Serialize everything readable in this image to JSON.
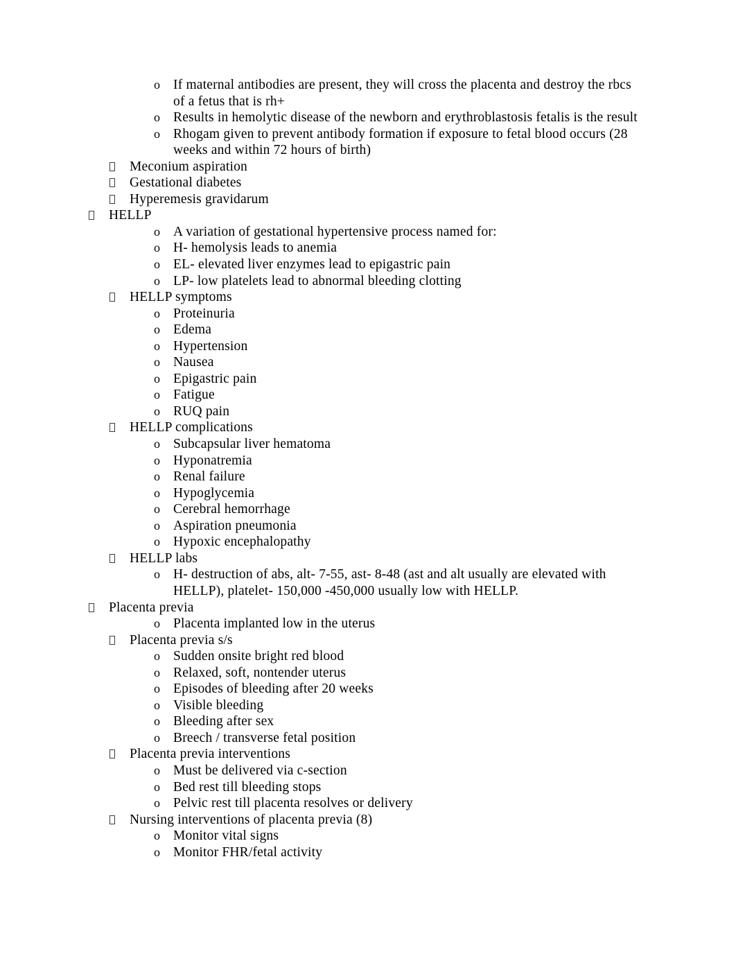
{
  "document": {
    "page_background": "#ffffff",
    "text_color": "#000000",
    "outline": [
      {
        "level": 3,
        "bullet": "o",
        "text": "If maternal antibodies are present, they will cross the placenta and destroy the rbcs of a fetus that is rh+"
      },
      {
        "level": 3,
        "bullet": "o",
        "text": "Results in hemolytic disease of the newborn and erythroblastosis fetalis is the result"
      },
      {
        "level": 3,
        "bullet": "o",
        "text": "Rhogam given to prevent antibody formation if exposure to fetal blood occurs (28 weeks and within 72 hours of birth)"
      },
      {
        "level": 2,
        "bullet": "box",
        "text": " Meconium aspiration"
      },
      {
        "level": 2,
        "bullet": "box",
        "text": "Gestational diabetes"
      },
      {
        "level": 2,
        "bullet": "box",
        "text": "Hyperemesis gravidarum"
      },
      {
        "level": 1,
        "bullet": "box",
        "text": "HELLP"
      },
      {
        "level": 3,
        "bullet": "o",
        "text": "A variation of gestational hypertensive process named for:"
      },
      {
        "level": 3,
        "bullet": "o",
        "text": "H- hemolysis leads to anemia"
      },
      {
        "level": 3,
        "bullet": "o",
        "text": "EL- elevated liver enzymes lead to epigastric pain"
      },
      {
        "level": 3,
        "bullet": "o",
        "text": "LP- low platelets lead to abnormal bleeding clotting"
      },
      {
        "level": 2,
        "bullet": "box",
        "text": "HELLP symptoms"
      },
      {
        "level": 3,
        "bullet": "o",
        "text": "Proteinuria"
      },
      {
        "level": 3,
        "bullet": "o",
        "text": "Edema"
      },
      {
        "level": 3,
        "bullet": "o",
        "text": "Hypertension"
      },
      {
        "level": 3,
        "bullet": "o",
        "text": "Nausea"
      },
      {
        "level": 3,
        "bullet": "o",
        "text": "Epigastric pain"
      },
      {
        "level": 3,
        "bullet": "o",
        "text": "Fatigue"
      },
      {
        "level": 3,
        "bullet": "o",
        "text": "RUQ pain"
      },
      {
        "level": 2,
        "bullet": "box",
        "text": "HELLP complications"
      },
      {
        "level": 3,
        "bullet": "o",
        "text": "Subcapsular liver hematoma"
      },
      {
        "level": 3,
        "bullet": "o",
        "text": "Hyponatremia"
      },
      {
        "level": 3,
        "bullet": "o",
        "text": "Renal failure"
      },
      {
        "level": 3,
        "bullet": "o",
        "text": "Hypoglycemia"
      },
      {
        "level": 3,
        "bullet": "o",
        "text": "Cerebral hemorrhage"
      },
      {
        "level": 3,
        "bullet": "o",
        "text": "Aspiration pneumonia"
      },
      {
        "level": 3,
        "bullet": "o",
        "text": "Hypoxic encephalopathy"
      },
      {
        "level": 2,
        "bullet": "box",
        "text": "HELLP labs"
      },
      {
        "level": 3,
        "bullet": "o",
        "text": "H- destruction of abs, alt- 7-55, ast- 8-48 (ast and alt usually are elevated with HELLP), platelet- 150,000 -450,000 usually low with HELLP."
      },
      {
        "level": 1,
        "bullet": "box",
        "text": "Placenta previa"
      },
      {
        "level": 3,
        "bullet": "o",
        "text": "Placenta implanted low in the uterus"
      },
      {
        "level": 2,
        "bullet": "box",
        "text": "Placenta previa s/s"
      },
      {
        "level": 3,
        "bullet": "o",
        "text": "Sudden onsite bright red blood"
      },
      {
        "level": 3,
        "bullet": "o",
        "text": "Relaxed, soft, nontender uterus"
      },
      {
        "level": 3,
        "bullet": "o",
        "text": "Episodes of bleeding after 20 weeks"
      },
      {
        "level": 3,
        "bullet": "o",
        "text": "Visible bleeding"
      },
      {
        "level": 3,
        "bullet": "o",
        "text": "Bleeding after sex"
      },
      {
        "level": 3,
        "bullet": "o",
        "text": "Breech / transverse fetal position"
      },
      {
        "level": 2,
        "bullet": "box",
        "text": "Placenta previa interventions"
      },
      {
        "level": 3,
        "bullet": "o",
        "text": "Must be delivered via c-section"
      },
      {
        "level": 3,
        "bullet": "o",
        "text": "Bed rest till bleeding stops"
      },
      {
        "level": 3,
        "bullet": "o",
        "text": "Pelvic rest till placenta resolves or delivery"
      },
      {
        "level": 2,
        "bullet": "box",
        "text": "Nursing interventions of placenta previa (8)"
      },
      {
        "level": 3,
        "bullet": "o",
        "text": "Monitor vital signs"
      },
      {
        "level": 3,
        "bullet": "o",
        "text": "Monitor FHR/fetal activity"
      }
    ]
  }
}
